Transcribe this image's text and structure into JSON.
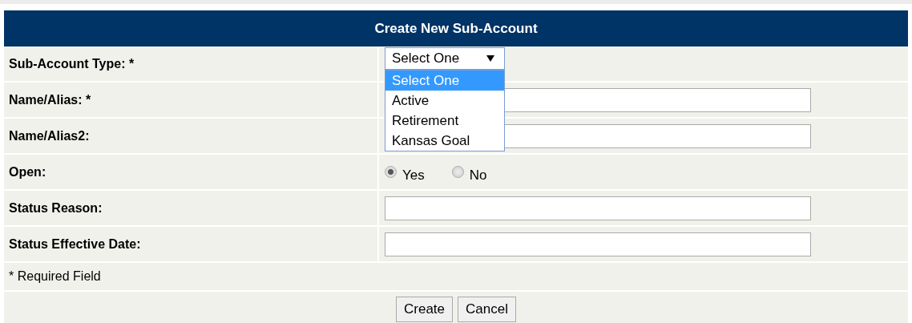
{
  "header": {
    "title": "Create New Sub-Account"
  },
  "fields": [
    {
      "kind": "select",
      "label": "Sub-Account Type: *",
      "value": "Select One",
      "expanded": true,
      "options": [
        {
          "label": "Select One",
          "selected": true
        },
        {
          "label": "Active",
          "selected": false
        },
        {
          "label": "Retirement",
          "selected": false
        },
        {
          "label": "Kansas Goal",
          "selected": false
        }
      ]
    },
    {
      "kind": "text",
      "label": "Name/Alias: *"
    },
    {
      "kind": "text",
      "label": "Name/Alias2:"
    },
    {
      "kind": "radio",
      "label": "Open:",
      "options": [
        {
          "label": "Yes",
          "selected": true
        },
        {
          "label": "No",
          "selected": false
        }
      ]
    },
    {
      "kind": "text",
      "label": "Status Reason:"
    },
    {
      "kind": "text",
      "label": "Status Effective Date:"
    }
  ],
  "note": "* Required Field",
  "buttons": [
    "Create",
    "Cancel"
  ]
}
